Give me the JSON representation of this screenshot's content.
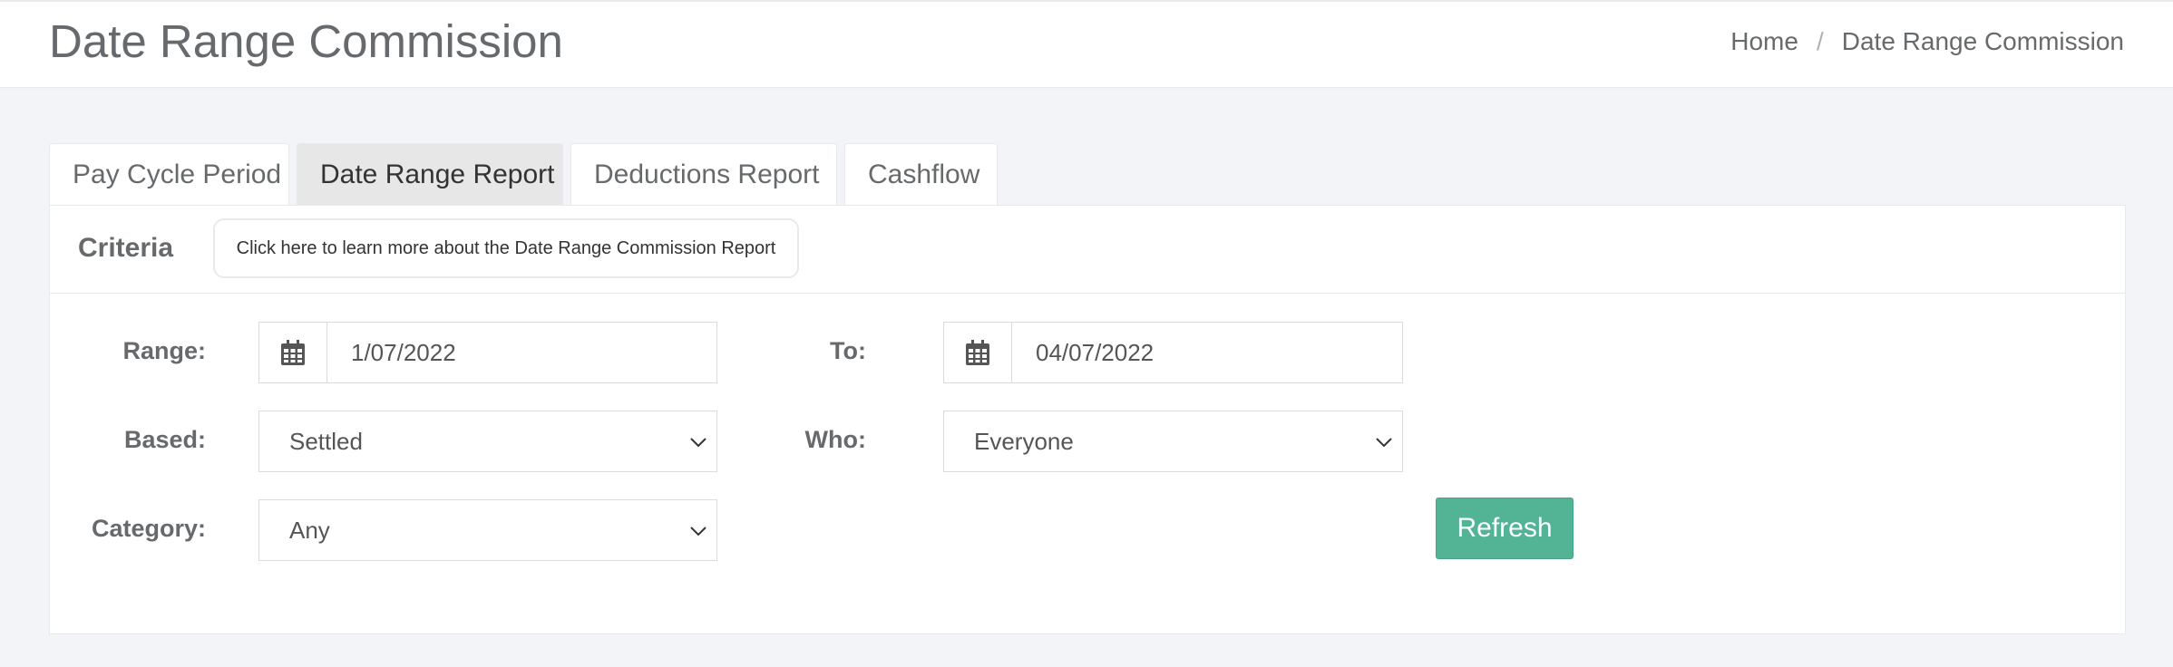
{
  "header": {
    "title": "Date Range Commission",
    "breadcrumb": [
      "Home",
      "Date Range Commission"
    ]
  },
  "tabs": [
    {
      "label": "Pay Cycle Period",
      "active": false
    },
    {
      "label": "Date Range Report",
      "active": true
    },
    {
      "label": "Deductions Report",
      "active": false
    },
    {
      "label": "Cashflow",
      "active": false
    }
  ],
  "criteria": {
    "title": "Criteria",
    "learn_more": "Click here to learn more about the Date Range Commission Report"
  },
  "form": {
    "range_label": "Range:",
    "range_value": "1/07/2022",
    "to_label": "To:",
    "to_value": "04/07/2022",
    "based_label": "Based:",
    "based_value": "Settled",
    "who_label": "Who:",
    "who_value": "Everyone",
    "category_label": "Category:",
    "category_value": "Any",
    "refresh_label": "Refresh"
  },
  "colors": {
    "accent": "#52b395",
    "background": "#f3f4f7",
    "text": "#676a6c"
  },
  "icons": {
    "calendar": "calendar-icon",
    "dropdown": "chevron-down-icon"
  }
}
